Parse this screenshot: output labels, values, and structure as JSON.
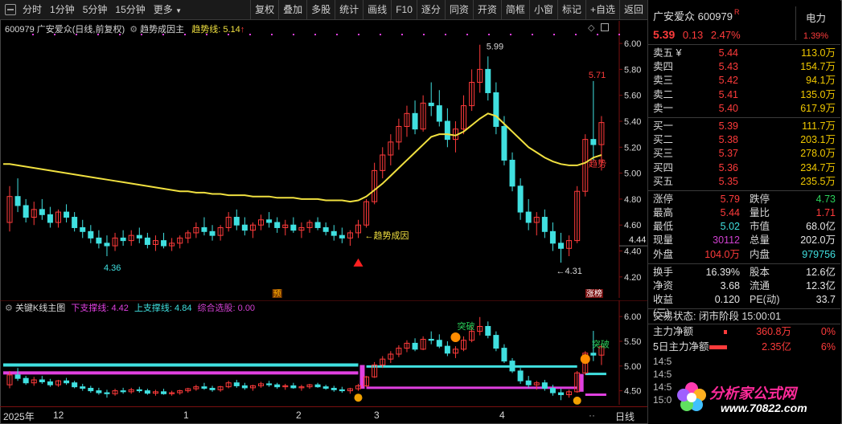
{
  "toolbar": {
    "left": [
      "分时",
      "1分钟",
      "5分钟",
      "15分钟",
      "更多"
    ],
    "right": [
      "复权",
      "叠加",
      "多股",
      "统计",
      "画线",
      "F10",
      "逐分",
      "同资",
      "开资",
      "简框",
      "小窗",
      "标记",
      "+自选",
      "返回"
    ]
  },
  "main_legend": {
    "code_name": "600979 广安爱众(日线,前复权)",
    "indicator": "趋势成因主",
    "trend_label": "趋势线: 5.14",
    "trend_arrow": "↑"
  },
  "main_axis": [
    "6.00",
    "5.80",
    "5.60",
    "5.40",
    "5.20",
    "5.00",
    "4.80",
    "4.60",
    "4.40",
    "4.20"
  ],
  "current_price_tag": "4.44",
  "annotations": {
    "high": "5.99",
    "low1": "4.36",
    "low2": "←4.31",
    "recent_high": "5.71",
    "trend_cause": "←趋势成因",
    "trend_side": "趋势",
    "yu": "预",
    "zhangbang": "涨榜"
  },
  "sub_legend": {
    "name": "关键K线主图",
    "lower": "下支撑线: 4.42",
    "upper": "上支撑线: 4.84",
    "select": "综合选股: 0.00"
  },
  "sub_axis": [
    "6.00",
    "5.50",
    "5.00",
    "4.50"
  ],
  "sub_labels": {
    "breakout1": "突破",
    "breakout2": "突破"
  },
  "time_axis": {
    "labels": [
      "2025年",
      "12",
      "1",
      "2",
      "3",
      "4"
    ],
    "period": "日线"
  },
  "quote": {
    "title": "广安爱众 600979",
    "badge": "R",
    "price": "5.39",
    "change": "0.13",
    "pct": "2.47%",
    "sector": "电力",
    "sector_pct": "1.39%",
    "asks": [
      {
        "label": "卖五 ¥",
        "price": "5.44",
        "vol": "113.0万"
      },
      {
        "label": "卖四",
        "price": "5.43",
        "vol": "154.7万"
      },
      {
        "label": "卖三",
        "price": "5.42",
        "vol": "94.1万"
      },
      {
        "label": "卖二",
        "price": "5.41",
        "vol": "135.0万"
      },
      {
        "label": "卖一",
        "price": "5.40",
        "vol": "617.9万"
      }
    ],
    "bids": [
      {
        "label": "买一",
        "price": "5.39",
        "vol": "111.7万"
      },
      {
        "label": "买二",
        "price": "5.38",
        "vol": "203.1万"
      },
      {
        "label": "买三",
        "price": "5.37",
        "vol": "278.0万"
      },
      {
        "label": "买四",
        "price": "5.36",
        "vol": "234.7万"
      },
      {
        "label": "买五",
        "price": "5.35",
        "vol": "235.5万"
      }
    ],
    "stats1": [
      {
        "l1": "涨停",
        "v1": "5.79",
        "l2": "跌停",
        "v2": "4.73",
        "c1": "",
        "c2": "green"
      },
      {
        "l1": "最高",
        "v1": "5.44",
        "l2": "量比",
        "v2": "1.71",
        "c1": "",
        "c2": ""
      },
      {
        "l1": "最低",
        "v1": "5.02",
        "l2": "市值",
        "v2": "68.0亿",
        "c1": "cyan",
        "c2": "white"
      },
      {
        "l1": "现量",
        "v1": "30112",
        "l2": "总量",
        "v2": "202.0万",
        "c1": "magenta",
        "c2": "white"
      },
      {
        "l1": "外盘",
        "v1": "104.0万",
        "l2": "内盘",
        "v2": "979756",
        "c1": "",
        "c2": "cyan"
      }
    ],
    "stats2": [
      {
        "l1": "换手",
        "v1": "16.39%",
        "l2": "股本",
        "v2": "12.6亿"
      },
      {
        "l1": "净资",
        "v1": "3.68",
        "l2": "流通",
        "v2": "12.3亿"
      },
      {
        "l1": "收益(三)",
        "v1": "0.120",
        "l2": "PE(动)",
        "v2": "33.7"
      }
    ],
    "trade_state": "交易状态: 闭市阶段 15:00:01",
    "flows": [
      {
        "label": "主力净额",
        "value": "360.8万",
        "pct": "0%",
        "bar": 4
      },
      {
        "label": "5日主力净额",
        "value": "2.35亿",
        "pct": "6%",
        "bar": 22
      }
    ],
    "partial_times": [
      "14:5",
      "14:5",
      "14:5",
      "15:0"
    ]
  },
  "logo": {
    "text": "分析家公式网",
    "url": "www.70822.com"
  },
  "chart_data": [
    {
      "type": "candlestick",
      "title": "600979 广安爱众(日线,前复权)",
      "ylim": [
        4.1,
        6.05
      ],
      "x": [
        "2024-12",
        "2025-01",
        "2025-02",
        "2025-03",
        "2025-04"
      ],
      "candles": [
        [
          4.62,
          4.9,
          4.55,
          4.82
        ],
        [
          4.82,
          4.96,
          4.7,
          4.75
        ],
        [
          4.75,
          4.8,
          4.62,
          4.66
        ],
        [
          4.66,
          4.78,
          4.6,
          4.72
        ],
        [
          4.72,
          4.8,
          4.64,
          4.68
        ],
        [
          4.68,
          4.74,
          4.58,
          4.62
        ],
        [
          4.62,
          4.72,
          4.58,
          4.7
        ],
        [
          4.7,
          4.76,
          4.62,
          4.66
        ],
        [
          4.66,
          4.7,
          4.55,
          4.58
        ],
        [
          4.58,
          4.64,
          4.5,
          4.55
        ],
        [
          4.55,
          4.6,
          4.46,
          4.5
        ],
        [
          4.5,
          4.56,
          4.42,
          4.46
        ],
        [
          4.46,
          4.52,
          4.36,
          4.44
        ],
        [
          4.44,
          4.54,
          4.4,
          4.5
        ],
        [
          4.5,
          4.56,
          4.44,
          4.48
        ],
        [
          4.48,
          4.56,
          4.44,
          4.52
        ],
        [
          4.52,
          4.58,
          4.46,
          4.5
        ],
        [
          4.5,
          4.54,
          4.42,
          4.45
        ],
        [
          4.45,
          4.52,
          4.4,
          4.48
        ],
        [
          4.48,
          4.54,
          4.42,
          4.44
        ],
        [
          4.44,
          4.5,
          4.4,
          4.46
        ],
        [
          4.46,
          4.52,
          4.42,
          4.5
        ],
        [
          4.5,
          4.56,
          4.46,
          4.54
        ],
        [
          4.54,
          4.62,
          4.5,
          4.58
        ],
        [
          4.58,
          4.66,
          4.52,
          4.55
        ],
        [
          4.55,
          4.6,
          4.48,
          4.52
        ],
        [
          4.52,
          4.6,
          4.48,
          4.58
        ],
        [
          4.58,
          4.7,
          4.55,
          4.66
        ],
        [
          4.66,
          4.72,
          4.56,
          4.6
        ],
        [
          4.6,
          4.66,
          4.52,
          4.56
        ],
        [
          4.56,
          4.62,
          4.5,
          4.6
        ],
        [
          4.6,
          4.68,
          4.56,
          4.64
        ],
        [
          4.64,
          4.7,
          4.58,
          4.62
        ],
        [
          4.62,
          4.66,
          4.54,
          4.58
        ],
        [
          4.58,
          4.64,
          4.52,
          4.6
        ],
        [
          4.6,
          4.66,
          4.54,
          4.56
        ],
        [
          4.56,
          4.62,
          4.5,
          4.58
        ],
        [
          4.58,
          4.64,
          4.54,
          4.62
        ],
        [
          4.62,
          4.66,
          4.56,
          4.58
        ],
        [
          4.58,
          4.62,
          4.52,
          4.55
        ],
        [
          4.55,
          4.6,
          4.48,
          4.52
        ],
        [
          4.52,
          4.58,
          4.46,
          4.5
        ],
        [
          4.5,
          4.56,
          4.44,
          4.54
        ],
        [
          4.54,
          4.64,
          4.5,
          4.6
        ],
        [
          4.6,
          4.8,
          4.58,
          4.78
        ],
        [
          4.78,
          5.08,
          4.76,
          5.02
        ],
        [
          5.02,
          5.2,
          4.96,
          5.14
        ],
        [
          5.14,
          5.3,
          5.06,
          5.24
        ],
        [
          5.24,
          5.42,
          5.18,
          5.36
        ],
        [
          5.36,
          5.52,
          5.28,
          5.46
        ],
        [
          5.46,
          5.56,
          5.3,
          5.34
        ],
        [
          5.34,
          5.6,
          5.32,
          5.54
        ],
        [
          5.54,
          5.7,
          5.44,
          5.52
        ],
        [
          5.52,
          5.64,
          5.36,
          5.4
        ],
        [
          5.4,
          5.5,
          5.2,
          5.26
        ],
        [
          5.26,
          5.4,
          5.16,
          5.34
        ],
        [
          5.34,
          5.6,
          5.3,
          5.52
        ],
        [
          5.52,
          5.8,
          5.48,
          5.7
        ],
        [
          5.7,
          5.99,
          5.62,
          5.8
        ],
        [
          5.8,
          5.9,
          5.56,
          5.62
        ],
        [
          5.62,
          5.7,
          5.3,
          5.36
        ],
        [
          5.36,
          5.44,
          5.06,
          5.1
        ],
        [
          5.1,
          5.16,
          4.86,
          4.9
        ],
        [
          4.9,
          4.96,
          4.64,
          4.7
        ],
        [
          4.7,
          4.8,
          4.56,
          4.62
        ],
        [
          4.62,
          4.7,
          4.52,
          4.66
        ],
        [
          4.66,
          4.72,
          4.5,
          4.55
        ],
        [
          4.55,
          4.62,
          4.4,
          4.46
        ],
        [
          4.46,
          4.54,
          4.31,
          4.42
        ],
        [
          4.42,
          4.52,
          4.36,
          4.48
        ],
        [
          4.48,
          4.9,
          4.46,
          4.86
        ],
        [
          4.86,
          5.3,
          4.82,
          5.26
        ],
        [
          5.26,
          5.71,
          5.1,
          5.22
        ],
        [
          5.22,
          5.44,
          5.02,
          5.39
        ]
      ],
      "series": [
        {
          "name": "趋势线",
          "values": [
            5.07,
            5.06,
            5.05,
            5.04,
            5.03,
            5.02,
            5.01,
            5.0,
            4.99,
            4.98,
            4.97,
            4.96,
            4.95,
            4.94,
            4.93,
            4.92,
            4.91,
            4.9,
            4.89,
            4.88,
            4.87,
            4.86,
            4.86,
            4.85,
            4.85,
            4.84,
            4.84,
            4.83,
            4.83,
            4.83,
            4.82,
            4.82,
            4.82,
            4.81,
            4.81,
            4.81,
            4.8,
            4.8,
            4.8,
            4.79,
            4.79,
            4.79,
            4.78,
            4.79,
            4.82,
            4.87,
            4.92,
            4.98,
            5.04,
            5.1,
            5.16,
            5.22,
            5.28,
            5.3,
            5.3,
            5.29,
            5.32,
            5.37,
            5.42,
            5.46,
            5.44,
            5.38,
            5.32,
            5.26,
            5.2,
            5.16,
            5.12,
            5.09,
            5.07,
            5.06,
            5.06,
            5.08,
            5.12,
            5.14
          ]
        }
      ]
    },
    {
      "type": "candlestick",
      "title": "关键K线主图",
      "ylim": [
        4.25,
        6.1
      ],
      "series": [
        {
          "name": "下支撑线",
          "values": [
            4.42
          ]
        },
        {
          "name": "上支撑线",
          "values": [
            4.84
          ]
        },
        {
          "name": "综合选股",
          "values": [
            0.0
          ]
        }
      ]
    }
  ]
}
